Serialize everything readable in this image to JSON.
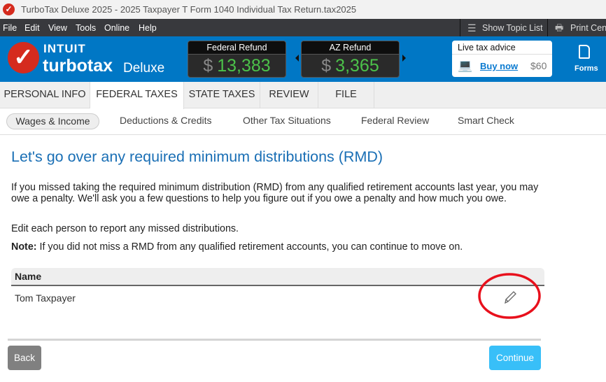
{
  "window": {
    "title": "TurboTax Deluxe 2025 - 2025 Taxpayer T Form 1040  Individual Tax Return.tax2025"
  },
  "menu": {
    "items": [
      "File",
      "Edit",
      "View",
      "Tools",
      "Online",
      "Help"
    ],
    "show_topic_list": "Show Topic List",
    "print_center": "Print Cent"
  },
  "brand": {
    "intuit": "INTUIT",
    "turbotax": "turbotax",
    "edition": "Deluxe"
  },
  "refunds": {
    "federal": {
      "label": "Federal Refund",
      "currency": "$",
      "amount": "13,383"
    },
    "state": {
      "label": "AZ Refund",
      "currency": "$",
      "amount": "3,365"
    }
  },
  "advice": {
    "title": "Live tax advice",
    "link": "Buy now",
    "price": "$60"
  },
  "forms": {
    "label": "Forms"
  },
  "tabs": [
    "PERSONAL INFO",
    "FEDERAL TAXES",
    "STATE TAXES",
    "REVIEW",
    "FILE"
  ],
  "subnav": [
    "Wages & Income",
    "Deductions & Credits",
    "Other Tax Situations",
    "Federal Review",
    "Smart Check"
  ],
  "main": {
    "heading": "Let's go over any required minimum distributions (RMD)",
    "para1": "If you missed taking the required minimum distribution (RMD) from any qualified retirement accounts last year, you may owe a penalty. We'll ask you a few questions to help you figure out if you owe a penalty and how much you owe.",
    "para2": "Edit each person to report any missed distributions.",
    "note_label": "Note:",
    "note_text": " If you did not miss a RMD from any qualified retirement accounts, you can continue to move on.",
    "table": {
      "header": "Name",
      "rows": [
        {
          "name": "Tom Taxpayer"
        }
      ]
    }
  },
  "buttons": {
    "back": "Back",
    "continue": "Continue"
  },
  "colors": {
    "brand_blue": "#0077c5",
    "refund_green": "#4cc24a",
    "continue": "#38bff8",
    "annotation": "#e8101c"
  }
}
